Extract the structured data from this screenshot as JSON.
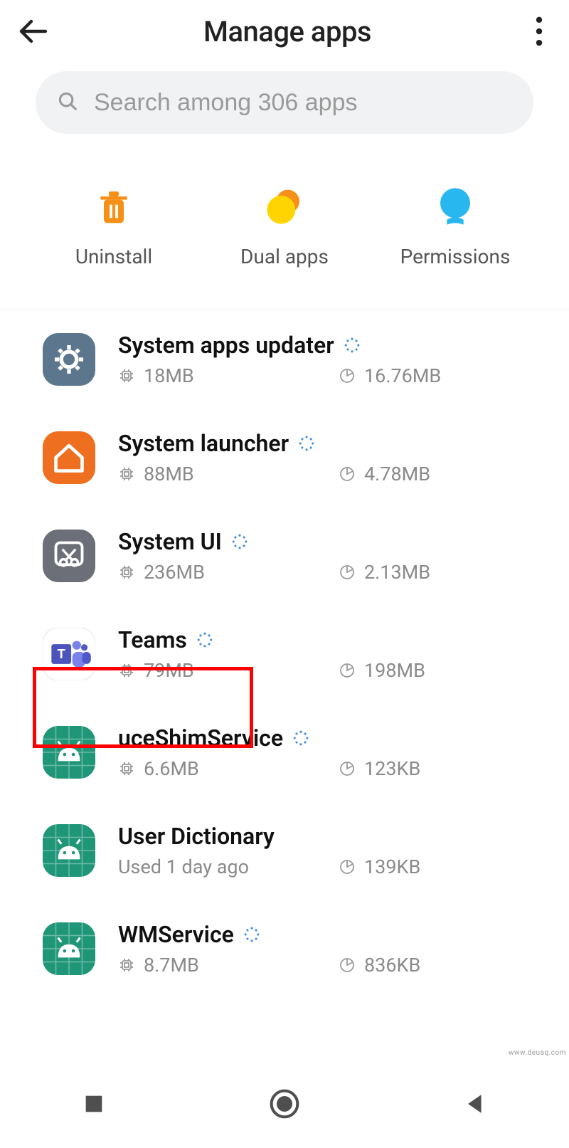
{
  "header": {
    "title": "Manage apps"
  },
  "search": {
    "placeholder": "Search among 306 apps"
  },
  "actions": {
    "uninstall": "Uninstall",
    "dual": "Dual apps",
    "permissions": "Permissions"
  },
  "apps": [
    {
      "name": "System apps updater",
      "storage": "18MB",
      "data": "16.76MB",
      "icon": "gear",
      "badge": true
    },
    {
      "name": "System launcher",
      "storage": "88MB",
      "data": "4.78MB",
      "icon": "home",
      "badge": true
    },
    {
      "name": "System UI",
      "storage": "236MB",
      "data": "2.13MB",
      "icon": "scissors",
      "badge": true
    },
    {
      "name": "Teams",
      "storage": "79MB",
      "data": "198MB",
      "icon": "teams",
      "badge": true,
      "highlight": true
    },
    {
      "name": "uceShimService",
      "storage": "6.6MB",
      "data": "123KB",
      "icon": "android",
      "badge": true
    },
    {
      "name": "User Dictionary",
      "used": "Used 1 day ago",
      "data": "139KB",
      "icon": "android",
      "badge": false
    },
    {
      "name": "WMService",
      "storage": "8.7MB",
      "data": "836KB",
      "icon": "android",
      "badge": true
    }
  ],
  "watermark": "www.deuaq.com"
}
